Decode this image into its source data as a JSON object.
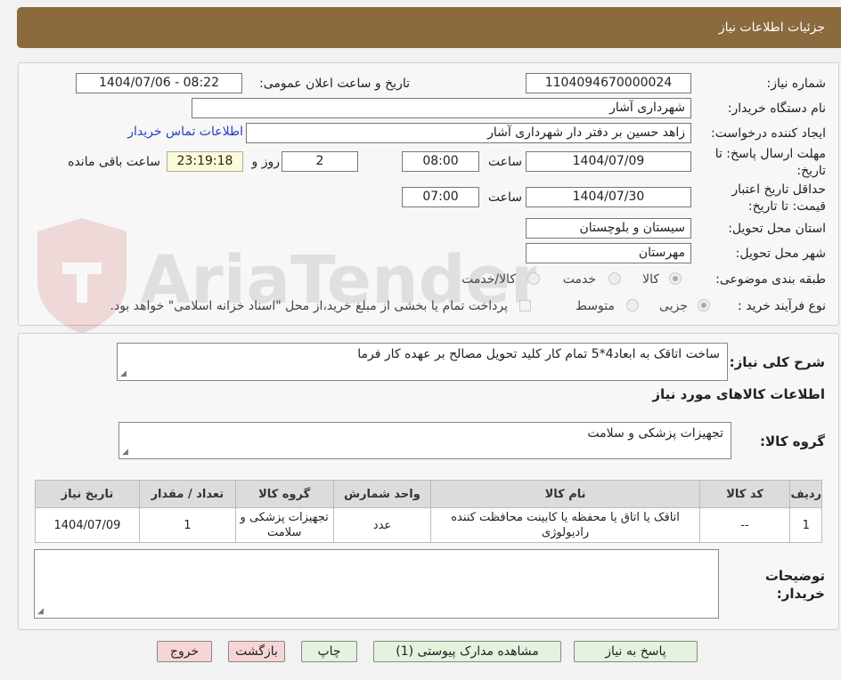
{
  "header": {
    "title": "جزئیات اطلاعات نیاز"
  },
  "watermark": {
    "text": "AriaTender.neT"
  },
  "form": {
    "need_number": {
      "label": "شماره نیاز:",
      "value": "1104094670000024"
    },
    "announce": {
      "label": "تاریخ و ساعت اعلان عمومی:",
      "value": "1404/07/06 - 08:22"
    },
    "buyer_org": {
      "label": "نام دستگاه خریدار:",
      "value": "شهرداری آشار"
    },
    "requester": {
      "label": "ایجاد کننده درخواست:",
      "value": "زاهد حسین بر دفتر دار شهرداری آشار",
      "contact_link": "اطلاعات تماس خریدار"
    },
    "reply_deadline": {
      "label_line1": "مهلت ارسال پاسخ: تا",
      "label_line2": "تاریخ:",
      "date": "1404/07/09",
      "time_label": "ساعت",
      "time": "08:00",
      "days": "2",
      "days_label": "روز و",
      "remaining": "23:19:18",
      "remaining_label": "ساعت باقی مانده"
    },
    "price_validity": {
      "label_line1": "حداقل تاریخ اعتبار",
      "label_line2": "قیمت: تا تاریخ:",
      "date": "1404/07/30",
      "time_label": "ساعت",
      "time": "07:00"
    },
    "province": {
      "label": "استان محل تحویل:",
      "value": "سیستان و بلوچستان"
    },
    "city": {
      "label": "شهر محل تحویل:",
      "value": "مهرستان"
    },
    "category": {
      "label": "طبقه بندی موضوعی:",
      "options": [
        "کالا",
        "خدمت",
        "کالا/خدمت"
      ],
      "selected": "کالا"
    },
    "process": {
      "label": "نوع فرآیند خرید :",
      "options": [
        "جزیی",
        "متوسط"
      ],
      "selected": "جزیی",
      "treasury_note": "پرداخت تمام یا بخشی از مبلغ خرید،از محل \"اسناد خزانه اسلامی\" خواهد بود."
    }
  },
  "description": {
    "label": "شرح کلی نیاز:",
    "value": "ساخت اتاقک به ابعاد4*5 تمام کار کلید تحویل مصالح بر عهده کار فرما"
  },
  "goods_section": {
    "title": "اطلاعات کالاهای مورد نیاز",
    "group_label": "گروه کالا:",
    "group_value": "تجهیزات پزشکی و سلامت"
  },
  "table": {
    "headers": [
      "ردیف",
      "کد کالا",
      "نام کالا",
      "واحد شمارش",
      "گروه کالا",
      "تعداد / مقدار",
      "تاریخ نیاز"
    ],
    "rows": [
      [
        "1",
        "--",
        "اتاقک یا اتاق یا محفظه یا کابینت محافظت کننده رادیولوژی",
        "عدد",
        "تجهیزات پزشکی و سلامت",
        "1",
        "1404/07/09"
      ]
    ]
  },
  "buyer_notes": {
    "label_line1": "توضیحات",
    "label_line2": "خریدار:",
    "value": ""
  },
  "buttons": {
    "reply": "پاسخ به نیاز",
    "attachments": "مشاهده مدارک پیوستی (1)",
    "print": "چاپ",
    "back": "بازگشت",
    "exit": "خروج"
  }
}
